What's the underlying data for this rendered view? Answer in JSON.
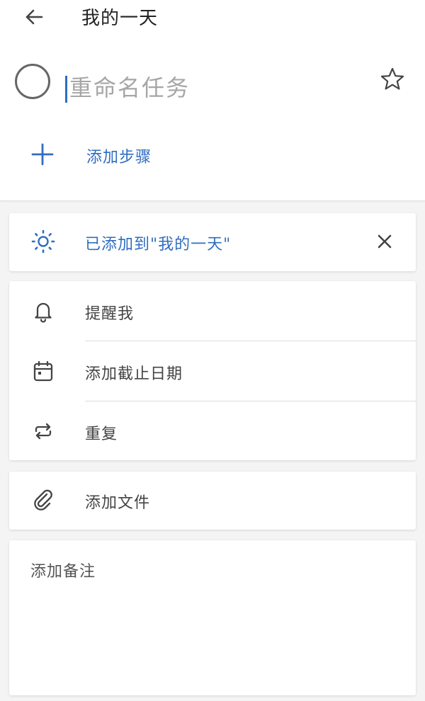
{
  "header": {
    "title": "我的一天"
  },
  "task": {
    "title_value": "",
    "title_placeholder": "重命名任务"
  },
  "steps": {
    "add_label": "添加步骤"
  },
  "my_day": {
    "label": "已添加到\"我的一天\""
  },
  "options": {
    "remind": "提醒我",
    "due_date": "添加截止日期",
    "repeat": "重复"
  },
  "files": {
    "label": "添加文件"
  },
  "note": {
    "placeholder": "添加备注"
  },
  "icons": {
    "back": "arrow-left",
    "complete": "circle-checkbox",
    "important": "star",
    "add": "plus",
    "my_day": "sun",
    "remove": "close",
    "remind": "bell",
    "due_date": "calendar",
    "repeat": "repeat",
    "file": "paperclip"
  },
  "colors": {
    "accent": "#2f6dc0",
    "background": "#f4f4f4",
    "card": "#ffffff"
  }
}
